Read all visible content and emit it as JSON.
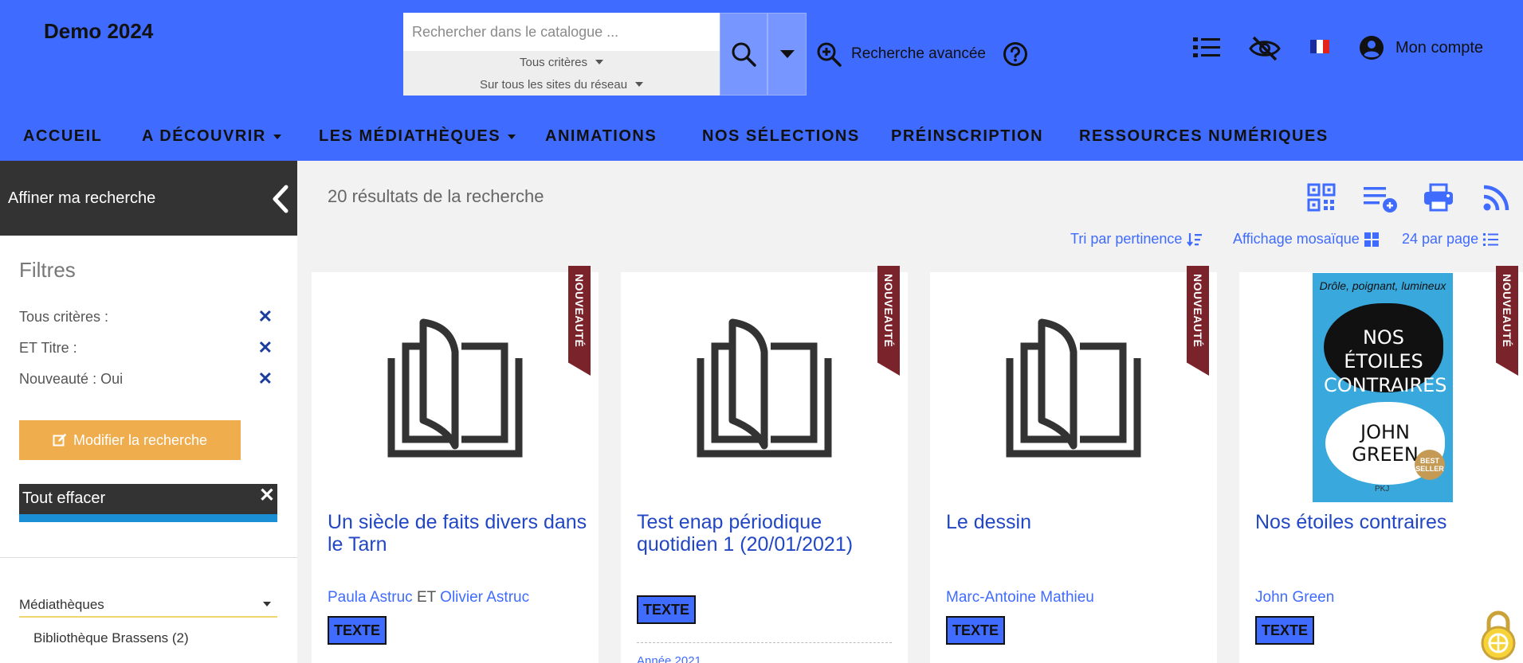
{
  "header": {
    "site_title": "Demo 2024",
    "search": {
      "placeholder": "Rechercher dans le catalogue ...",
      "criteria": "Tous critères",
      "scope": "Sur tous les sites du réseau"
    },
    "advanced_search": "Recherche avancée",
    "account": "Mon compte"
  },
  "nav": {
    "items": [
      {
        "label": "ACCUEIL"
      },
      {
        "label": "A DÉCOUVRIR"
      },
      {
        "label": "LES MÉDIATHÈQUES"
      },
      {
        "label": "ANIMATIONS"
      },
      {
        "label": "NOS SÉLECTIONS"
      },
      {
        "label": "PRÉINSCRIPTION"
      },
      {
        "label": "RESSOURCES NUMÉRIQUES"
      }
    ]
  },
  "sidebar": {
    "refine_title": "Affiner ma recherche",
    "filters_title": "Filtres",
    "filters": [
      {
        "label": "Tous critères :"
      },
      {
        "label": "ET Titre :"
      },
      {
        "label": "Nouveauté : Oui"
      }
    ],
    "modify_button": "Modifier la recherche",
    "clear_button": "Tout effacer",
    "facet_title": "Médiathèques",
    "facet_items": [
      {
        "label": "Bibliothèque Brassens (2)"
      }
    ]
  },
  "results": {
    "count_text": "20 résultats de la recherche",
    "sort_label": "Tri par pertinence",
    "display_label": "Affichage mosaïque",
    "per_page_label": "24 par page"
  },
  "cards": [
    {
      "title": "Un siècle de faits divers dans le Tarn",
      "author1": "Paula Astruc",
      "author_sep": "ET",
      "author2": "Olivier Astruc",
      "badge": "TEXTE",
      "ribbon": "NOUVEAUTÉ"
    },
    {
      "title": "Test enap périodique quotidien 1 (20/01/2021)",
      "badge": "TEXTE",
      "ribbon": "NOUVEAUTÉ",
      "meta_peek": "Année 2021"
    },
    {
      "title": "Le dessin",
      "author1": "Marc-Antoine Mathieu",
      "badge": "TEXTE",
      "ribbon": "NOUVEAUTÉ"
    },
    {
      "title": "Nos étoiles contraires",
      "author1": "John Green",
      "badge": "TEXTE",
      "ribbon": "NOUVEAUTÉ",
      "cover": {
        "tagline": "Drôle, poignant, lumineux",
        "title": "NOS ÉTOILES CONTRAIRES",
        "author": "JOHN GREEN",
        "seal": "BEST SELLER",
        "publisher": "PKJ"
      }
    }
  ],
  "colors": {
    "header_bg": "#3f6bff",
    "sidebar_dark": "#333333",
    "ribbon": "#7b232a",
    "modify_button": "#f0ad4e",
    "link": "#2247c4"
  }
}
